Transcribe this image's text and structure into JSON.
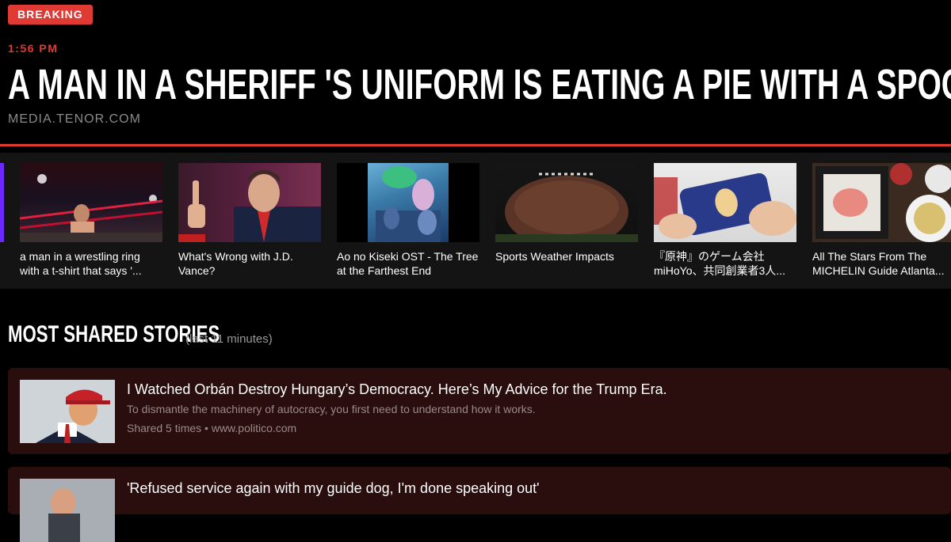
{
  "badge": "BREAKING",
  "time": "1:56 PM",
  "headline": "A man in a sheriff 's uniform is eating a pie with a spoon",
  "source": "MEDIA.TENOR.COM",
  "cards": [
    {
      "label": "a man in a wrestling ring with a t-shirt that says '..."
    },
    {
      "label": "What's Wrong with J.D. Vance?"
    },
    {
      "label": "Ao no Kiseki OST - The Tree at the Farthest End"
    },
    {
      "label": "Sports Weather Impacts"
    },
    {
      "label": "『原神』のゲーム会社miHoYo、共同創業者3人..."
    },
    {
      "label": "All The Stars From The MICHELIN Guide Atlanta..."
    }
  ],
  "section": {
    "title": "Most Shared Stories",
    "subtitle": "(last 11 minutes)"
  },
  "stories": [
    {
      "title": "I Watched Orbán Destroy Hungary’s Democracy. Here’s My Advice for the Trump Era.",
      "description": "To dismantle the machinery of autocracy, you first need to understand how it works.",
      "meta": "Shared 5 times • www.politico.com"
    },
    {
      "title": "'Refused service again with my guide dog, I'm done speaking out'",
      "description": "",
      "meta": ""
    }
  ],
  "colors": {
    "accent": "#e03a35",
    "strip": "#141414",
    "story_bg": "#2a0d0d"
  }
}
